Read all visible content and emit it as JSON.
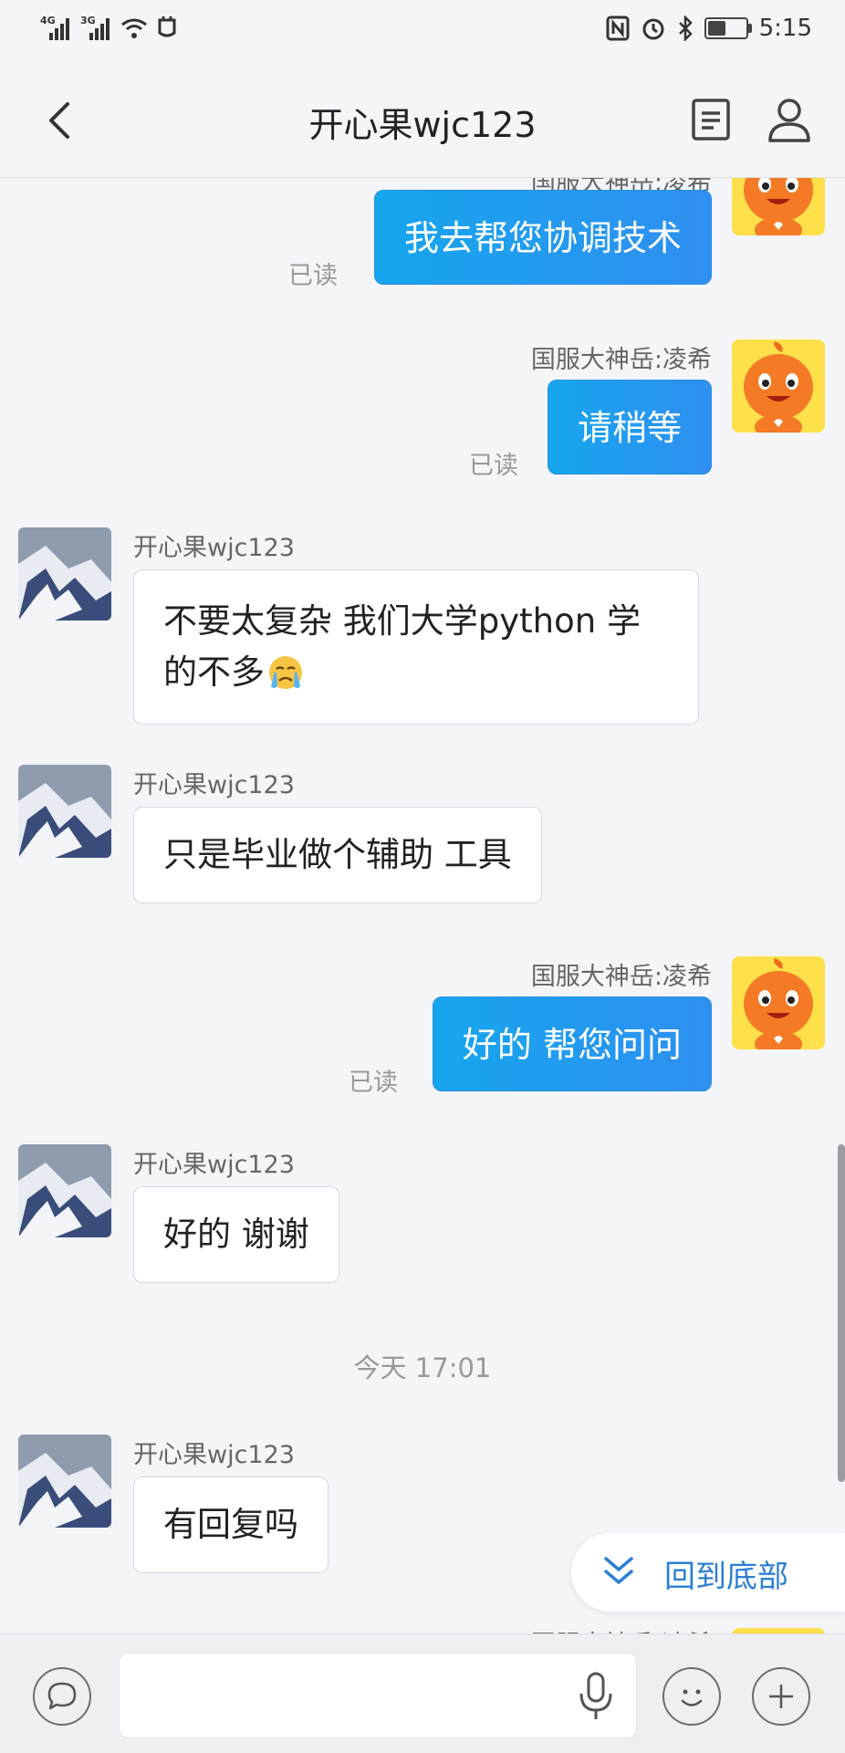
{
  "status_bar": {
    "network_1": "4G",
    "network_2": "3G",
    "time": "5:15",
    "icons": [
      "signal-4g-icon",
      "signal-3g-icon",
      "wifi-icon",
      "notification-icon",
      "nfc-icon",
      "alarm-icon",
      "bluetooth-icon",
      "battery-icon"
    ],
    "battery_level": 0.45
  },
  "header": {
    "title": "开心果wjc123",
    "back_icon": "chevron-left-icon",
    "doc_icon": "document-icon",
    "profile_icon": "person-icon"
  },
  "messages": [
    {
      "side": "right",
      "sender": "国服大神岳:凌希",
      "text": "我去帮您协调技术",
      "status": "已读"
    },
    {
      "side": "right",
      "sender": "国服大神岳:凌希",
      "text": "请稍等",
      "status": "已读"
    },
    {
      "side": "left",
      "sender": "开心果wjc123",
      "line1": "不要太复杂 我们大学python 学",
      "line2": "的不多",
      "emoji": "crying-face-emoji"
    },
    {
      "side": "left",
      "sender": "开心果wjc123",
      "text": "只是毕业做个辅助 工具"
    },
    {
      "side": "right",
      "sender": "国服大神岳:凌希",
      "text": "好的 帮您问问",
      "status": "已读"
    },
    {
      "side": "left",
      "sender": "开心果wjc123",
      "text": "好的 谢谢"
    },
    {
      "timestamp": "今天  17:01"
    },
    {
      "side": "left",
      "sender": "开心果wjc123",
      "text": "有回复吗"
    },
    {
      "side": "right",
      "sender": "国服大神岳:凌希",
      "partial": true
    }
  ],
  "scroll_button": {
    "label": "回到底部",
    "icon": "double-chevron-down-icon"
  },
  "input_bar": {
    "text_value": "",
    "icons": [
      "chat-bubble-icon",
      "microphone-icon",
      "emoji-icon",
      "plus-icon"
    ]
  },
  "colors": {
    "accent": "#1a9ff0",
    "background": "#f4f5f9",
    "link": "#2d7fd3"
  }
}
